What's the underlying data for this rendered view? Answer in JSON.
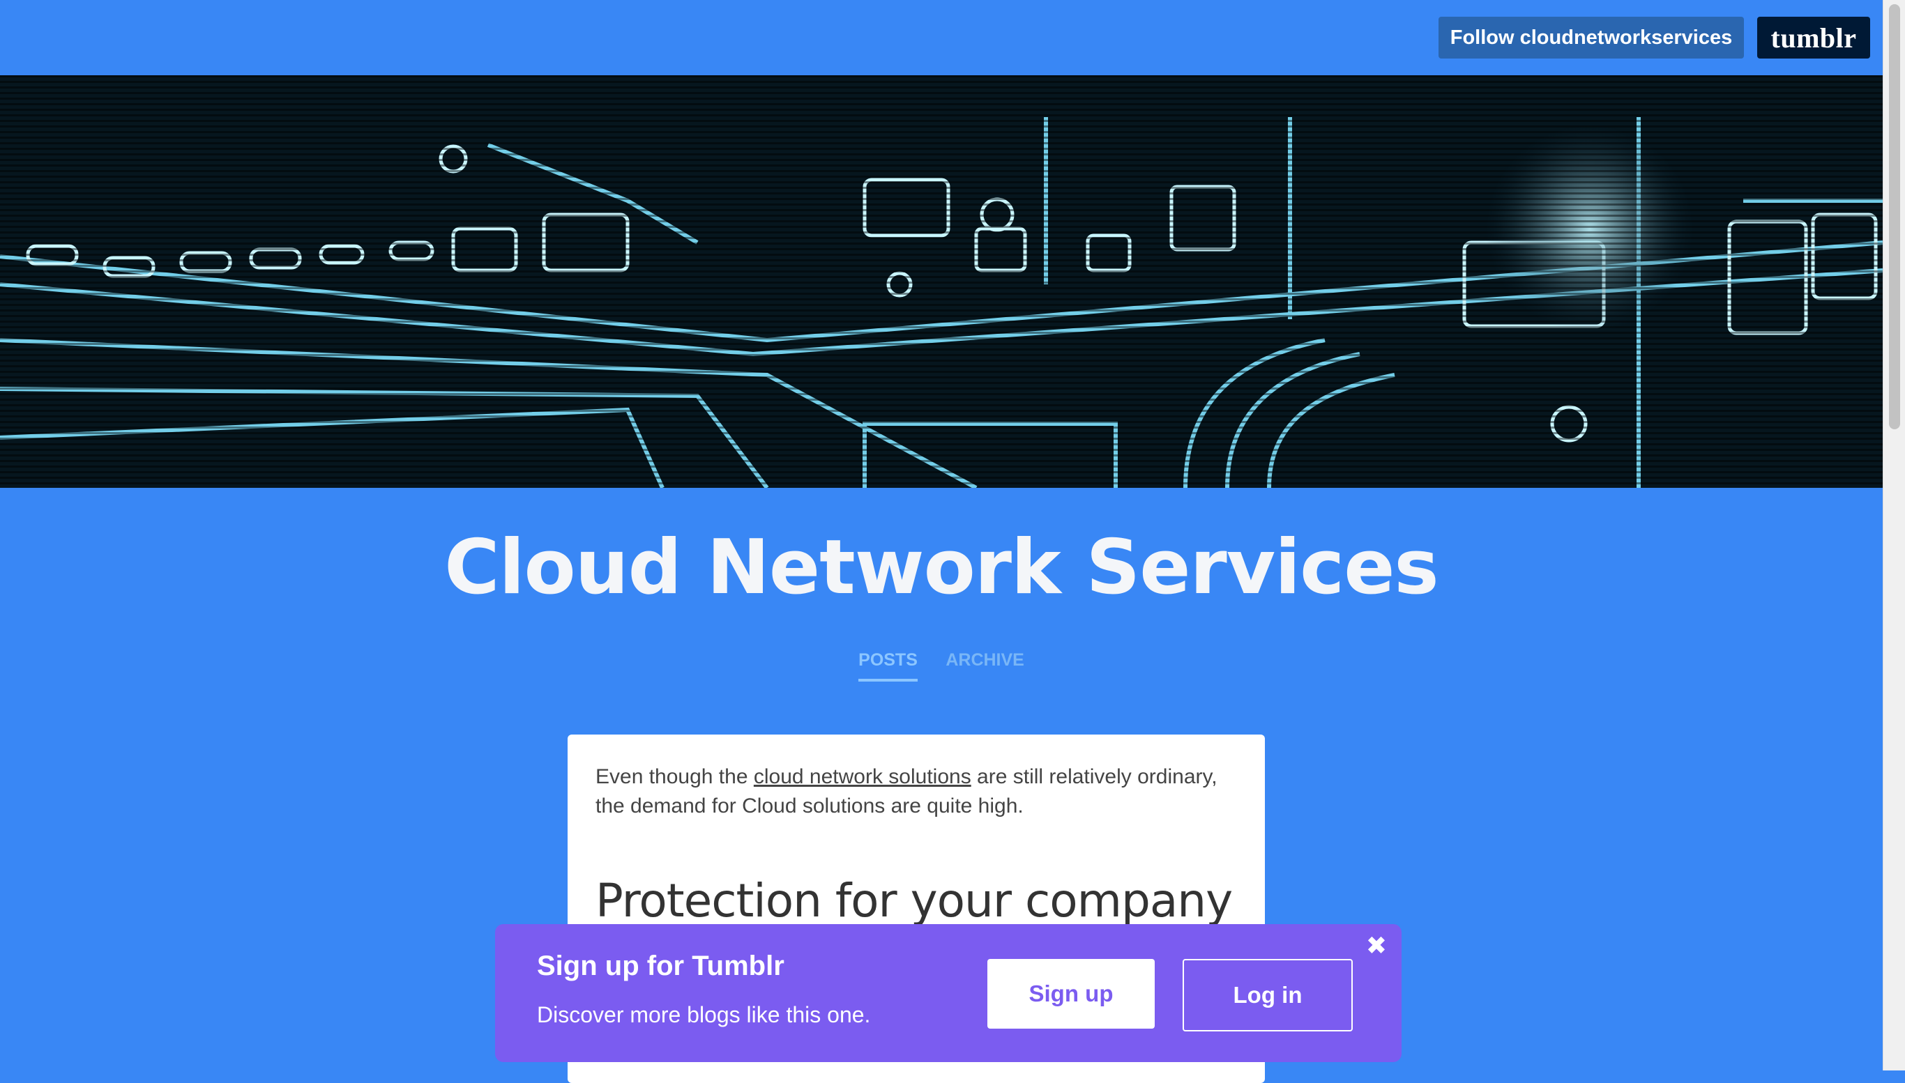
{
  "header": {
    "follow_label": "Follow cloudnetworkservices",
    "logo_text": "tumblr"
  },
  "blog": {
    "title": "Cloud Network Services"
  },
  "nav": {
    "items": [
      {
        "label": "POSTS",
        "active": true
      },
      {
        "label": "ARCHIVE",
        "active": false
      }
    ]
  },
  "post": {
    "text_before_link": "Even though the ",
    "link_text": "cloud network solutions",
    "text_after_link": " are still relatively ordinary, the demand for Cloud solutions are quite high.",
    "heading": "Protection for your company"
  },
  "signup_banner": {
    "title": "Sign up for Tumblr",
    "subtitle": "Discover more blogs like this one.",
    "signup_label": "Sign up",
    "login_label": "Log in",
    "close_icon": "close-icon"
  },
  "colors": {
    "background": "#3987f5",
    "follow_button": "#2a66b0",
    "tumblr_logo_bg": "#001935",
    "signup_banner": "#7b5cf0",
    "nav_active": "#8cc6ff"
  }
}
